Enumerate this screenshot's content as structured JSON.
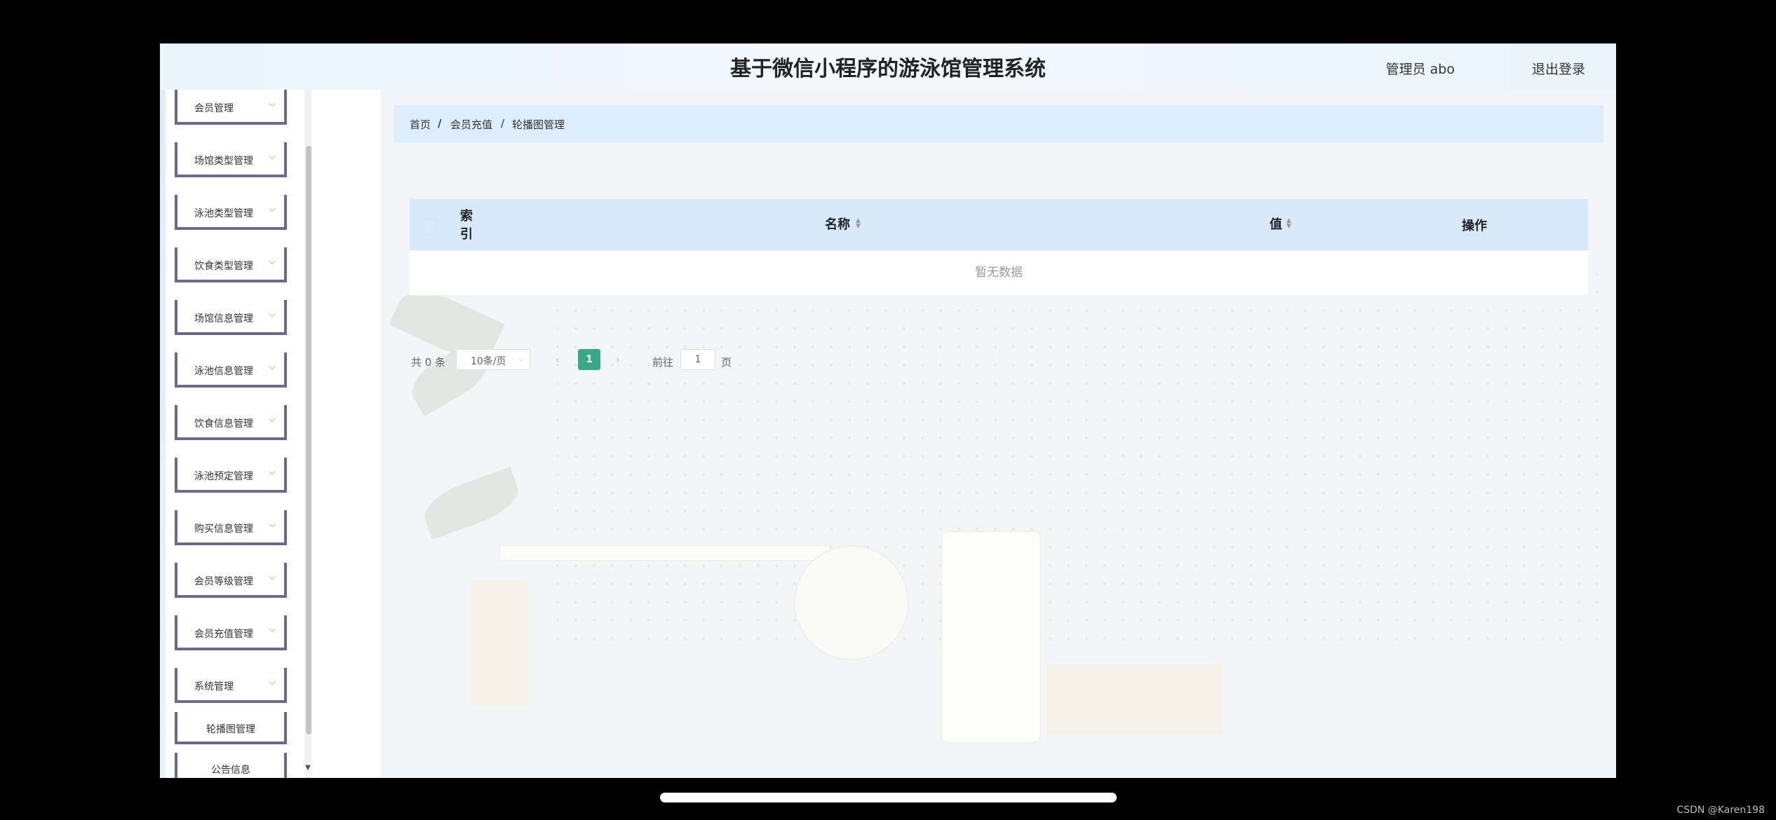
{
  "header": {
    "title": "基于微信小程序的游泳馆管理系统",
    "user_label": "管理员 abo",
    "logout_label": "退出登录"
  },
  "sidebar": {
    "items": [
      {
        "label": "会员管理"
      },
      {
        "label": "场馆类型管理"
      },
      {
        "label": "泳池类型管理"
      },
      {
        "label": "饮食类型管理"
      },
      {
        "label": "场馆信息管理"
      },
      {
        "label": "泳池信息管理"
      },
      {
        "label": "饮食信息管理"
      },
      {
        "label": "泳池预定管理"
      },
      {
        "label": "购买信息管理"
      },
      {
        "label": "会员等级管理"
      },
      {
        "label": "会员充值管理"
      },
      {
        "label": "系统管理"
      }
    ],
    "sub_items": [
      {
        "label": "轮播图管理"
      },
      {
        "label": "公告信息"
      }
    ]
  },
  "breadcrumb": {
    "home": "首页",
    "sep1": "/",
    "level2": "会员充值",
    "sep2": "/",
    "current": "轮播图管理"
  },
  "table": {
    "columns": {
      "index_line1": "索",
      "index_line2": "引",
      "name": "名称",
      "value": "值",
      "actions": "操作"
    },
    "empty_text": "暂无数据"
  },
  "pagination": {
    "total": "共 0 条",
    "page_size": "10条/页",
    "current_page": "1",
    "goto_label": "前往",
    "goto_value": "1",
    "page_suffix": "页"
  },
  "watermark": "CSDN @Karen198",
  "colors": {
    "header_bg": "#eaf4fd",
    "breadcrumb_bg": "#dcedfb",
    "table_header_bg": "#d6eafc",
    "active_page": "#3aa886"
  }
}
